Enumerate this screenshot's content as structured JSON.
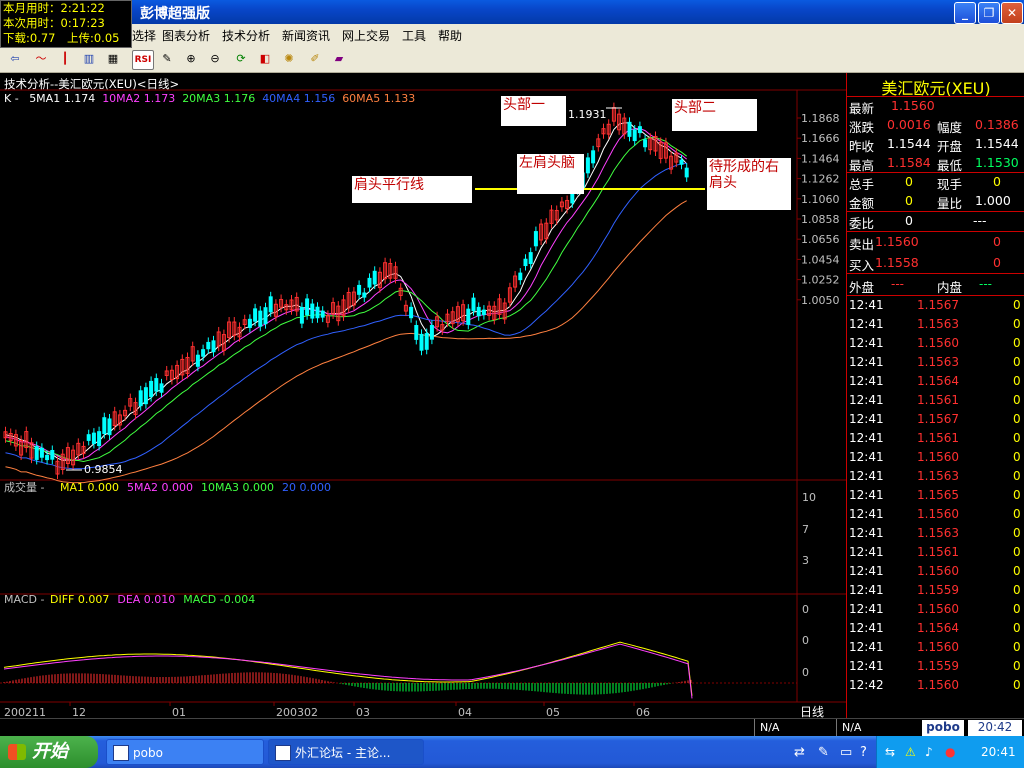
{
  "window": {
    "title": "彭博超强版"
  },
  "timebox": {
    "line1": "本月用时：2:21:22",
    "line2": "本次用时：0:17:23",
    "line3": "下载:0.77　上传:0.05"
  },
  "menu": [
    "选择",
    "图表分析",
    "技术分析",
    "新闻资讯",
    "网上交易",
    "工具",
    "帮助"
  ],
  "toolbar": {
    "rsi_label": "RSI"
  },
  "chart": {
    "title": "技术分析--美汇欧元(XEU)<日线>",
    "ma_prefix": "K -",
    "ma_items": [
      {
        "label": "5MA1",
        "value": "1.174",
        "color": "#ffffff"
      },
      {
        "label": "10MA2",
        "value": "1.173",
        "color": "#ff40ff"
      },
      {
        "label": "20MA3",
        "value": "1.176",
        "color": "#40ff40"
      },
      {
        "label": "40MA4",
        "value": "1.156",
        "color": "#3060ff"
      },
      {
        "label": "60MA5",
        "value": "1.133",
        "color": "#ff8040"
      }
    ],
    "price_axis": [
      "1.1868",
      "1.1666",
      "1.1464",
      "1.1262",
      "1.1060",
      "1.0858",
      "1.0656",
      "1.0454",
      "1.0252",
      "1.0050"
    ],
    "low_label": "0.9854",
    "high_label": "1.1931",
    "annotations": {
      "head1": "头部一",
      "head2": "头部二",
      "left_shoulder": "左肩头脑",
      "neckline": "肩头平行线",
      "right_shoulder": "待形成的右肩头"
    },
    "volume_header": {
      "prefix": "成交量 -",
      "items": [
        {
          "label": "MA1",
          "value": "0.000",
          "color": "#ffff00"
        },
        {
          "label": "5MA2",
          "value": "0.000",
          "color": "#ff40ff"
        },
        {
          "label": "10MA3",
          "value": "0.000",
          "color": "#40ff40"
        },
        {
          "label": "20",
          "value": "0.000",
          "color": "#3060ff"
        }
      ]
    },
    "volume_axis": [
      "10",
      "7",
      "3"
    ],
    "macd_header": {
      "prefix": "MACD -",
      "items": [
        {
          "label": "DIFF",
          "value": "0.007",
          "color": "#ffff00"
        },
        {
          "label": "DEA",
          "value": "0.010",
          "color": "#ff40ff"
        },
        {
          "label": "MACD",
          "value": "-0.004",
          "color": "#40ff40"
        }
      ]
    },
    "macd_axis": [
      "0",
      "0",
      "0"
    ],
    "x_axis": [
      "200211",
      "12",
      "01",
      "200302",
      "03",
      "04",
      "05",
      "06"
    ],
    "period_label": "日线"
  },
  "quote": {
    "title": "美汇欧元(XEU)",
    "latest_label": "最新",
    "latest": "1.1560",
    "change_label": "涨跌",
    "change": "0.0016",
    "pct_label": "幅度",
    "pct": "0.1386",
    "prev_label": "昨收",
    "prev": "1.1544",
    "open_label": "开盘",
    "open": "1.1544",
    "high_label": "最高",
    "high": "1.1584",
    "low_label": "最低",
    "low": "1.1530",
    "total_label": "总手",
    "total": "0",
    "now_label": "现手",
    "now": "0",
    "amount_label": "金额",
    "amount": "0",
    "ratio_label": "量比",
    "ratio": "1.000",
    "weibi_label": "委比",
    "weibi": "0",
    "weibi_diff": "---",
    "sell_label": "卖出",
    "sell": "1.1560",
    "sell_vol": "0",
    "buy_label": "买入",
    "buy": "1.1558",
    "buy_vol": "0",
    "outer_label": "外盘",
    "outer": "---",
    "inner_label": "内盘",
    "inner": "---",
    "ticks": [
      {
        "t": "12:41",
        "p": "1.1567",
        "v": "0"
      },
      {
        "t": "12:41",
        "p": "1.1563",
        "v": "0"
      },
      {
        "t": "12:41",
        "p": "1.1560",
        "v": "0"
      },
      {
        "t": "12:41",
        "p": "1.1563",
        "v": "0"
      },
      {
        "t": "12:41",
        "p": "1.1564",
        "v": "0"
      },
      {
        "t": "12:41",
        "p": "1.1561",
        "v": "0"
      },
      {
        "t": "12:41",
        "p": "1.1567",
        "v": "0"
      },
      {
        "t": "12:41",
        "p": "1.1561",
        "v": "0"
      },
      {
        "t": "12:41",
        "p": "1.1560",
        "v": "0"
      },
      {
        "t": "12:41",
        "p": "1.1563",
        "v": "0"
      },
      {
        "t": "12:41",
        "p": "1.1565",
        "v": "0"
      },
      {
        "t": "12:41",
        "p": "1.1560",
        "v": "0"
      },
      {
        "t": "12:41",
        "p": "1.1563",
        "v": "0"
      },
      {
        "t": "12:41",
        "p": "1.1561",
        "v": "0"
      },
      {
        "t": "12:41",
        "p": "1.1560",
        "v": "0"
      },
      {
        "t": "12:41",
        "p": "1.1559",
        "v": "0"
      },
      {
        "t": "12:41",
        "p": "1.1560",
        "v": "0"
      },
      {
        "t": "12:41",
        "p": "1.1564",
        "v": "0"
      },
      {
        "t": "12:41",
        "p": "1.1560",
        "v": "0"
      },
      {
        "t": "12:41",
        "p": "1.1559",
        "v": "0"
      },
      {
        "t": "12:42",
        "p": "1.1560",
        "v": "0"
      }
    ]
  },
  "status": {
    "na1": "N/A",
    "na2": "N/A",
    "brand": "pobo",
    "clock": "20:42"
  },
  "taskbar": {
    "start": "开始",
    "task1": "pobo",
    "task2": "外汇论坛 - 主论...",
    "tray_time": "20:41"
  },
  "colors": {
    "bg": "#000000",
    "up": "#ff3030",
    "down": "#00ffff",
    "grid": "#800000"
  }
}
